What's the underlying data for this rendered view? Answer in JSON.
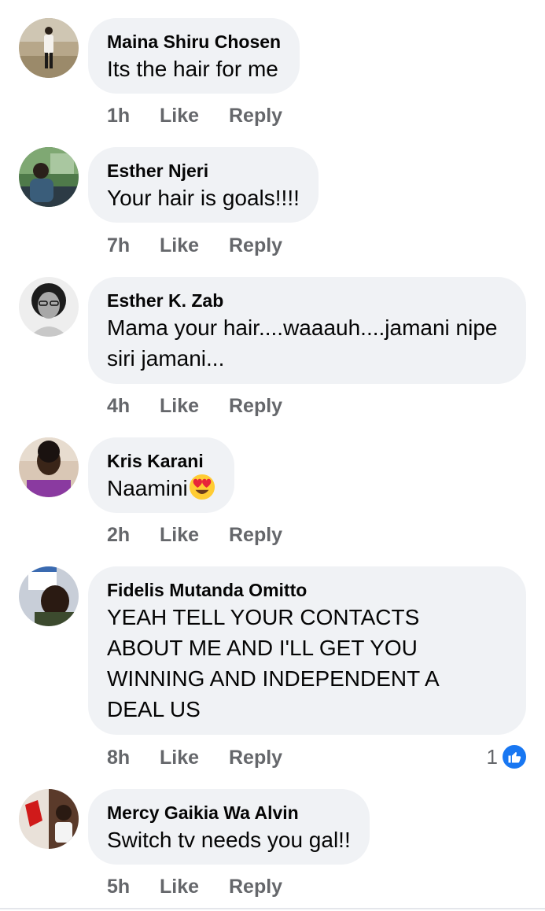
{
  "comments": [
    {
      "author": "Maina Shiru Chosen",
      "text": "Its the hair for me",
      "time": "1h",
      "like": "Like",
      "reply": "Reply",
      "avatar": "avatar-photo-person-standing"
    },
    {
      "author": "Esther Njeri",
      "text": "Your hair is goals!!!!",
      "time": "7h",
      "like": "Like",
      "reply": "Reply",
      "avatar": "avatar-photo-person-in-car"
    },
    {
      "author": "Esther K. Zab",
      "text": "Mama your hair....waaauh....jamani nipe siri jamani...",
      "time": "4h",
      "like": "Like",
      "reply": "Reply",
      "avatar": "avatar-photo-woman-glasses"
    },
    {
      "author": "Kris Karani",
      "text": "Naamini",
      "emoji": "smiling-face-with-heart-eyes",
      "time": "2h",
      "like": "Like",
      "reply": "Reply",
      "avatar": "avatar-photo-person-portrait"
    },
    {
      "author": "Fidelis Mutanda Omitto",
      "text": "YEAH TELL YOUR CONTACTS ABOUT ME AND I'LL GET YOU WINNING AND INDEPENDENT A DEAL US",
      "time": "8h",
      "like": "Like",
      "reply": "Reply",
      "reaction_count": "1",
      "reaction_icon": "thumbs-up-icon",
      "avatar": "avatar-photo-man-with-calendar"
    },
    {
      "author": "Mercy Gaikia Wa Alvin",
      "text": "Switch tv needs you gal!!",
      "time": "5h",
      "like": "Like",
      "reply": "Reply",
      "avatar": "avatar-photo-collage"
    }
  ],
  "colors": {
    "bubble": "#f0f2f5",
    "meta": "#65676b",
    "like_blue": "#1877f2"
  }
}
